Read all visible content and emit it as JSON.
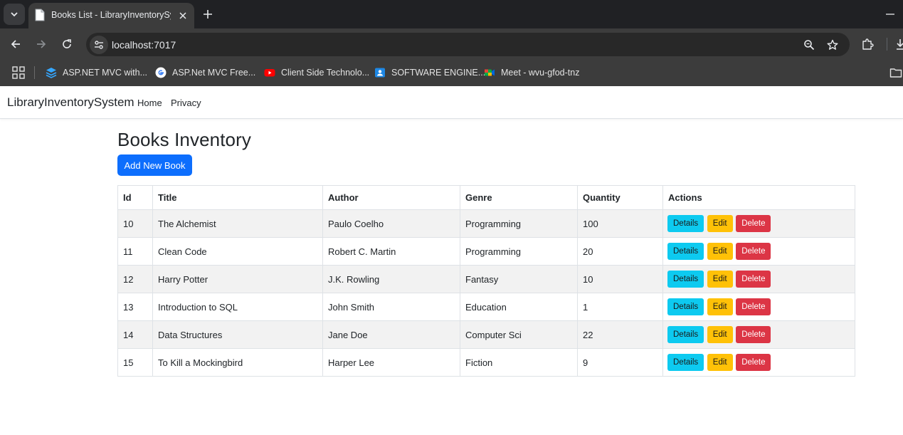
{
  "browser": {
    "tab_title": "Books List - LibraryInventorySystem",
    "url": "localhost:7017",
    "bookmarks": [
      {
        "label": "ASP.NET MVC with...",
        "icon": "stack-icon"
      },
      {
        "label": "ASP.Net MVC Free...",
        "icon": "google-icon"
      },
      {
        "label": "Client Side Technolo...",
        "icon": "youtube-icon"
      },
      {
        "label": "SOFTWARE ENGINE...",
        "icon": "classroom-icon"
      },
      {
        "label": "Meet - wvu-gfod-tnz",
        "icon": "meet-icon"
      }
    ]
  },
  "site": {
    "brand": "LibraryInventorySystem",
    "nav": [
      "Home",
      "Privacy"
    ]
  },
  "page": {
    "title": "Books Inventory",
    "add_button": "Add New Book",
    "columns": [
      "Id",
      "Title",
      "Author",
      "Genre",
      "Quantity",
      "Actions"
    ],
    "rows": [
      {
        "id": "10",
        "title": "The Alchemist",
        "author": "Paulo Coelho",
        "genre": "Programming",
        "quantity": "100"
      },
      {
        "id": "11",
        "title": "Clean Code",
        "author": "Robert C. Martin",
        "genre": "Programming",
        "quantity": "20"
      },
      {
        "id": "12",
        "title": "Harry Potter",
        "author": "J.K. Rowling",
        "genre": "Fantasy",
        "quantity": "10"
      },
      {
        "id": "13",
        "title": "Introduction to SQL",
        "author": "John Smith",
        "genre": "Education",
        "quantity": "1"
      },
      {
        "id": "14",
        "title": "Data Structures",
        "author": "Jane Doe",
        "genre": "Computer Sci",
        "quantity": "22"
      },
      {
        "id": "15",
        "title": "To Kill a Mockingbird",
        "author": "Harper Lee",
        "genre": "Fiction",
        "quantity": "9"
      }
    ],
    "actions": {
      "details": "Details",
      "edit": "Edit",
      "delete": "Delete"
    }
  },
  "colors": {
    "primary": "#0d6efd",
    "info": "#0dcaf0",
    "warning": "#ffc107",
    "danger": "#dc3545"
  }
}
